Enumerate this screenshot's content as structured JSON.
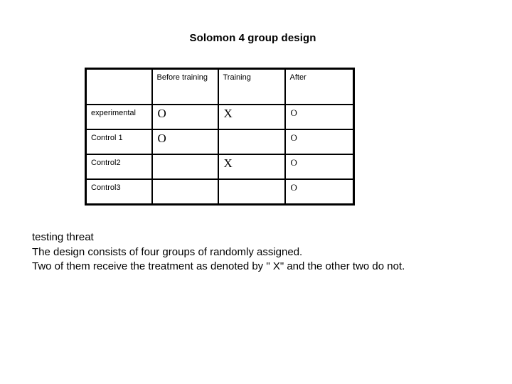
{
  "slide": {
    "title": "Solomon 4 group design"
  },
  "table": {
    "columns": [
      "",
      "Before training",
      "Training",
      "After"
    ],
    "rows": [
      {
        "label": "experimental",
        "before": "O",
        "training": "X",
        "after": "O"
      },
      {
        "label": "Control 1",
        "before": "O",
        "training": "",
        "after": "O"
      },
      {
        "label": "Control2",
        "before": "",
        "training": "X",
        "after": "O"
      },
      {
        "label": "Control3",
        "before": "",
        "training": "",
        "after": "O"
      }
    ]
  },
  "body": {
    "lines": [
      "testing threat",
      "The design consists of four groups of randomly assigned.",
      "Two of them receive the treatment as denoted by \" X\" and the other two do not."
    ]
  },
  "colors": {
    "background": "#ffffff",
    "text": "#000000",
    "border": "#000000"
  }
}
